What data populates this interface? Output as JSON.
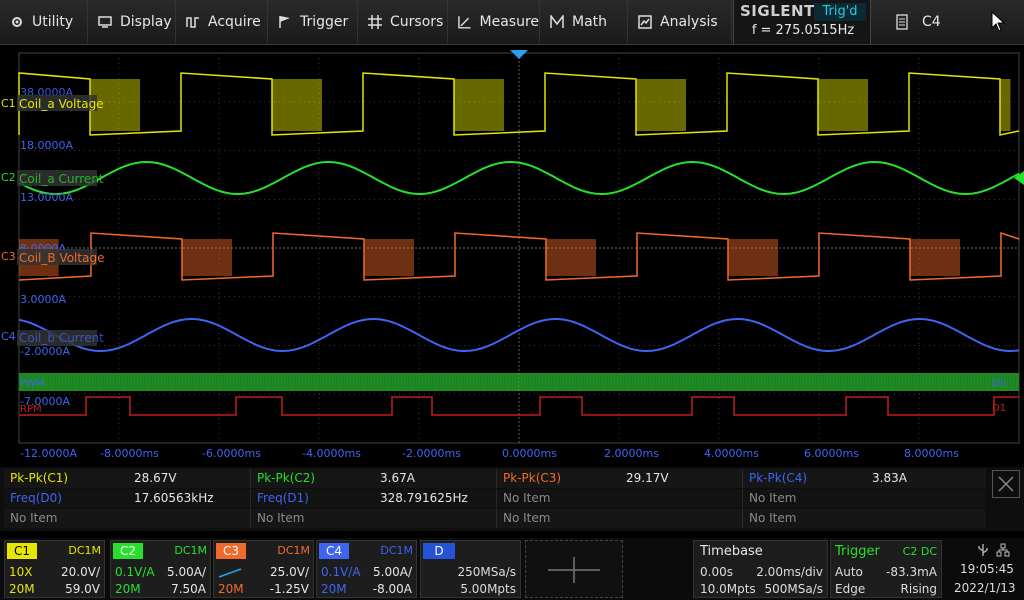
{
  "menu": {
    "utility": "Utility",
    "display": "Display",
    "acquire": "Acquire",
    "trigger": "Trigger",
    "cursors": "Cursors",
    "measure": "Measure",
    "math": "Math",
    "analysis": "Analysis",
    "c4": "C4"
  },
  "brand": {
    "logo": "SIGLENT",
    "status": "Trig'd",
    "freq": "f = 275.0515Hz"
  },
  "traces": {
    "c1": {
      "label": "Coil_a Voltage",
      "marker": "C1",
      "top_value": "38.0000A",
      "bottom_value": "18.0000A",
      "color": "#e6e600"
    },
    "c2": {
      "label": "Coil_a Current",
      "marker": "C2",
      "bottom_value": "13.0000A",
      "color": "#27e02b"
    },
    "c3": {
      "label": "Coil_B Voltage",
      "marker": "C3",
      "top_value": "8.0000A",
      "bottom_value": "3.0000A",
      "color": "#f26a2b"
    },
    "c4": {
      "label": "Coil_b Current",
      "marker": "C4",
      "top_value": "-2.0000A",
      "color": "#3f64f0"
    },
    "d0": {
      "label": "PWM",
      "value": "-7.0000A",
      "marker": "D0"
    },
    "d1": {
      "label": "RPM",
      "marker": "D1"
    }
  },
  "axis": {
    "bottom_left": "-12.0000A",
    "time_labels": [
      "-8.0000ms",
      "-6.0000ms",
      "-4.0000ms",
      "-2.0000ms",
      "0.0000ms",
      "2.0000ms",
      "4.0000ms",
      "6.0000ms",
      "8.0000ms"
    ]
  },
  "measurements": [
    [
      {
        "name": "Pk-Pk(C1)",
        "value": "28.67V",
        "color": "#e6e600"
      },
      {
        "name": "Pk-Pk(C2)",
        "value": "3.67A",
        "color": "#27e02b"
      },
      {
        "name": "Pk-Pk(C3)",
        "value": "29.17V",
        "color": "#f26a2b"
      },
      {
        "name": "Pk-Pk(C4)",
        "value": "3.83A",
        "color": "#3f64f0"
      }
    ],
    [
      {
        "name": "Freq(D0)",
        "value": "17.60563kHz",
        "color": "#3f64f0"
      },
      {
        "name": "Freq(D1)",
        "value": "328.791625Hz",
        "color": "#3f64f0"
      },
      {
        "name": "No Item",
        "value": "",
        "color": "#8a8a8a"
      },
      {
        "name": "No Item",
        "value": "",
        "color": "#8a8a8a"
      }
    ],
    [
      {
        "name": "No Item",
        "value": "",
        "color": "#8a8a8a"
      },
      {
        "name": "No Item",
        "value": "",
        "color": "#8a8a8a"
      },
      {
        "name": "No Item",
        "value": "",
        "color": "#8a8a8a"
      },
      {
        "name": "No Item",
        "value": "",
        "color": "#8a8a8a"
      }
    ]
  ],
  "channels": [
    {
      "tag": "C1",
      "coupling": "DC1M",
      "probe": "10X",
      "scale": "20.0V/",
      "bw": "20M",
      "offset": "59.0V",
      "color": "#e6e600"
    },
    {
      "tag": "C2",
      "coupling": "DC1M",
      "probe": "0.1V/A",
      "scale": "5.00A/",
      "bw": "20M",
      "offset": "7.50A",
      "color": "#27e02b"
    },
    {
      "tag": "C3",
      "coupling": "DC1M",
      "probe": "",
      "scale": "25.0V/",
      "bw": "20M",
      "offset": "-1.25V",
      "color": "#f26a2b"
    },
    {
      "tag": "C4",
      "coupling": "DC1M",
      "probe": "0.1V/A",
      "scale": "5.00A/",
      "bw": "20M",
      "offset": "-8.00A",
      "color": "#3f64f0"
    }
  ],
  "digital": {
    "tag": "D",
    "rate": "250MSa/s",
    "depth": "5.00Mpts"
  },
  "timebase": {
    "title": "Timebase",
    "delay": "0.00s",
    "scale": "2.00ms/div",
    "depth": "10.0Mpts",
    "rate": "500MSa/s"
  },
  "trigger": {
    "title": "Trigger",
    "source": "C2 DC",
    "mode": "Auto",
    "level": "-83.3mA",
    "type": "Edge",
    "slope": "Rising"
  },
  "clock": {
    "time": "19:05:45",
    "date": "2022/1/13"
  }
}
